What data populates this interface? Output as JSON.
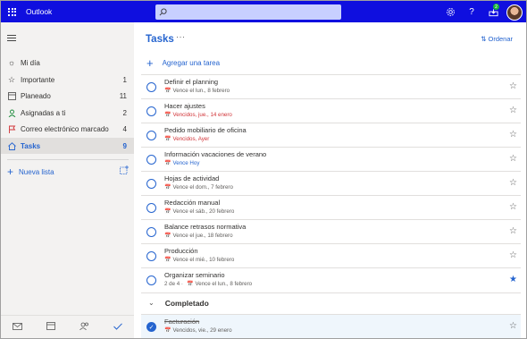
{
  "app": {
    "title": "Outlook"
  },
  "search": {
    "placeholder": ""
  },
  "topbar": {
    "notification_count": "2"
  },
  "watermark": "",
  "sidebar": {
    "items": [
      {
        "label": "Mi día",
        "count": "",
        "icon": "sun-icon"
      },
      {
        "label": "Importante",
        "count": "1",
        "icon": "star-icon"
      },
      {
        "label": "Planeado",
        "count": "11",
        "icon": "calendar-grid-icon"
      },
      {
        "label": "Asignadas a ti",
        "count": "2",
        "icon": "person-icon"
      },
      {
        "label": "Correo electrónico marcado",
        "count": "4",
        "icon": "flag-icon"
      },
      {
        "label": "Tasks",
        "count": "9",
        "icon": "home-icon"
      }
    ],
    "new_list": "Nueva lista"
  },
  "main": {
    "title": "Tasks",
    "more": "···",
    "sort": "Ordenar",
    "add_task": "Agregar una tarea",
    "tasks": [
      {
        "title": "Definir el planning",
        "meta": "Vence el lun., 8 febrero",
        "status": "normal",
        "starred": false
      },
      {
        "title": "Hacer ajustes",
        "meta": "Vencidos, jue., 14 enero",
        "status": "overdue",
        "starred": false
      },
      {
        "title": "Pedido mobiliario de oficina",
        "meta": "Vencidos, Ayer",
        "status": "overdue",
        "starred": false
      },
      {
        "title": "Información vacaciones de verano",
        "meta": "Vence Hoy",
        "status": "today",
        "starred": false
      },
      {
        "title": "Hojas de actividad",
        "meta": "Vence el dom., 7 febrero",
        "status": "normal",
        "starred": false
      },
      {
        "title": "Redacción manual",
        "meta": "Vence el sáb., 20 febrero",
        "status": "normal",
        "starred": false
      },
      {
        "title": "Balance retrasos normativa",
        "meta": "Vence el jue., 18 febrero",
        "status": "normal",
        "starred": false
      },
      {
        "title": "Producción",
        "meta": "Vence el mié., 10 febrero",
        "status": "normal",
        "starred": false
      },
      {
        "title": "Organizar seminario",
        "steps": "2 de 4 ·",
        "meta": "Vence el lun., 8 febrero",
        "status": "normal",
        "starred": true
      }
    ],
    "completed_label": "Completado",
    "completed": [
      {
        "title": "Facturación",
        "meta": "Vencidos, vie., 29 enero"
      }
    ]
  },
  "colors": {
    "accent": "#2564cf",
    "topbar": "#0f0fdf",
    "overdue": "#d13438"
  }
}
